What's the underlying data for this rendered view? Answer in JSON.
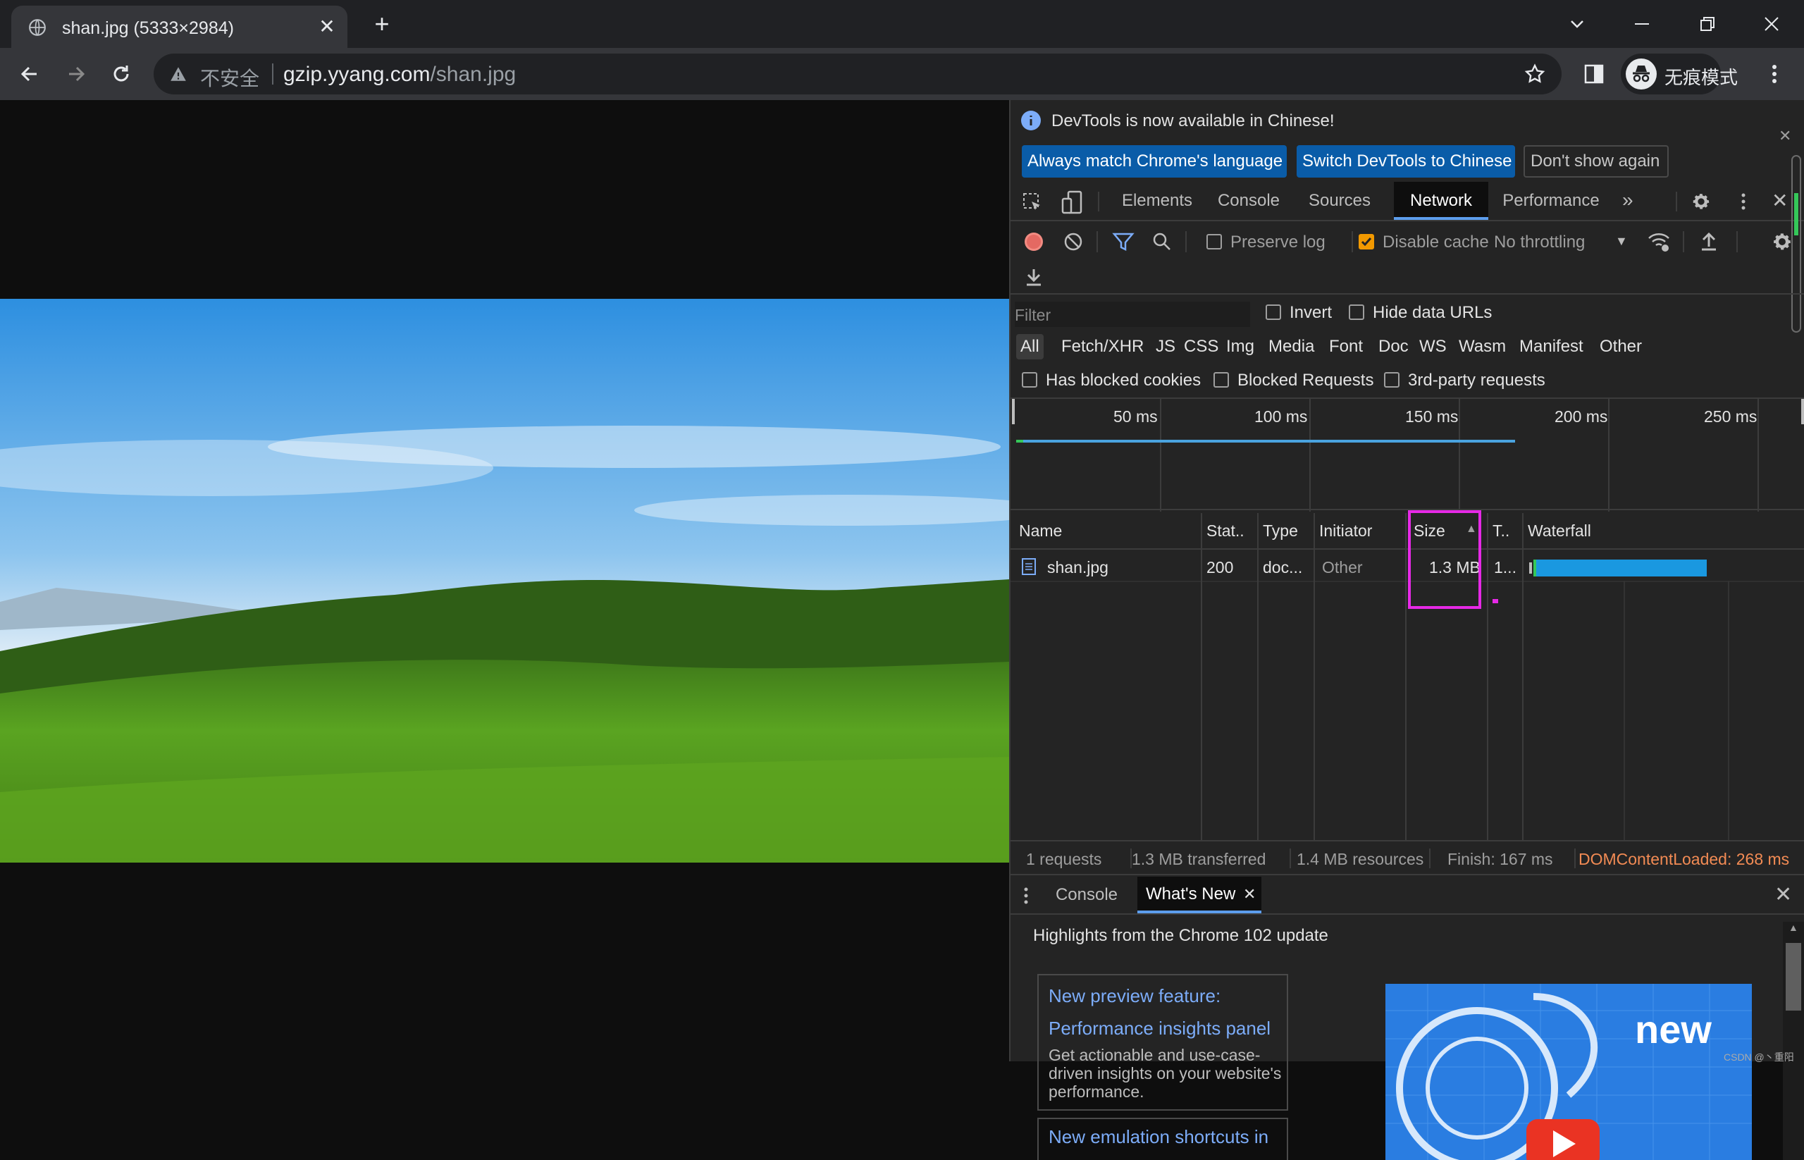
{
  "browser": {
    "tab_title": "shan.jpg (5333×2984)",
    "security_label": "不安全",
    "url_host": "gzip.yyang.com",
    "url_path": "/shan.jpg",
    "incognito_label": "无痕模式"
  },
  "devtools": {
    "infobar": {
      "message": "DevTools is now available in Chinese!",
      "btn_match": "Always match Chrome's language",
      "btn_switch": "Switch DevTools to Chinese",
      "btn_dont_show": "Don't show again"
    },
    "main_tabs": [
      "Elements",
      "Console",
      "Sources",
      "Network",
      "Performance"
    ],
    "active_tab": "Network",
    "network_toolbar": {
      "preserve_log": "Preserve log",
      "disable_cache": "Disable cache",
      "throttling": "No throttling"
    },
    "filter": {
      "placeholder": "Filter",
      "invert": "Invert",
      "hide_data_urls": "Hide data URLs",
      "types": [
        "All",
        "Fetch/XHR",
        "JS",
        "CSS",
        "Img",
        "Media",
        "Font",
        "Doc",
        "WS",
        "Wasm",
        "Manifest",
        "Other"
      ],
      "has_blocked_cookies": "Has blocked cookies",
      "blocked_requests": "Blocked Requests",
      "third_party": "3rd-party requests"
    },
    "timeline_ticks": [
      "50 ms",
      "100 ms",
      "150 ms",
      "200 ms",
      "250 ms"
    ],
    "table": {
      "headers": [
        "Name",
        "Stat..",
        "Type",
        "Initiator",
        "Size",
        "T..",
        "Waterfall"
      ],
      "rows": [
        {
          "name": "shan.jpg",
          "status": "200",
          "type": "doc...",
          "initiator": "Other",
          "size": "1.3 MB",
          "time": "1..."
        }
      ]
    },
    "status_bar": {
      "requests": "1 requests",
      "transferred": "1.3 MB transferred",
      "resources": "1.4 MB resources",
      "finish": "Finish: 167 ms",
      "dcl": "DOMContentLoaded: 268 ms"
    },
    "drawer": {
      "tabs": [
        "Console",
        "What's New"
      ],
      "heading": "Highlights from the Chrome 102 update",
      "card1_title": "New preview feature:",
      "card1_link": "Performance insights panel",
      "card1_desc": "Get actionable and use-case-driven insights on your website's performance.",
      "card2_title": "New emulation shortcuts in",
      "video_text": "new"
    }
  },
  "watermark": "CSDN @丶重阳"
}
